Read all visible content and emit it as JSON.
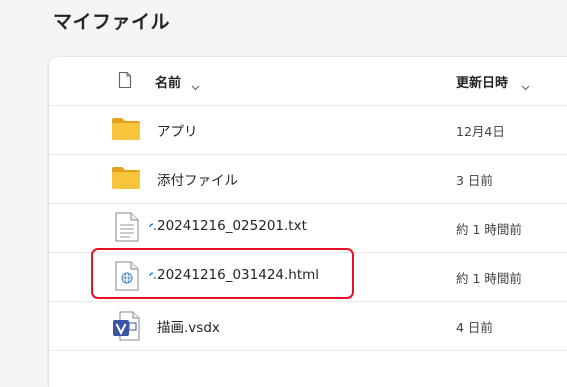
{
  "page": {
    "title": "マイファイル"
  },
  "header": {
    "name_label": "名前",
    "modified_label": "更新日時",
    "type_icon": "document-icon",
    "sort_icon": "chevron-down-icon"
  },
  "files": [
    {
      "name": "アプリ",
      "modified": "12月4日",
      "icon": "folder-icon"
    },
    {
      "name": "添付ファイル",
      "modified": "3 日前",
      "icon": "folder-icon"
    },
    {
      "name": "20241216_025201.txt",
      "modified": "約 1 時間前",
      "icon": "text-file-icon",
      "sync_status": "syncing"
    },
    {
      "name": "20241216_031424.html",
      "modified": "約 1 時間前",
      "icon": "html-file-icon",
      "sync_status": "syncing",
      "highlighted": true
    },
    {
      "name": "描画.vsdx",
      "modified": "4 日前",
      "icon": "visio-file-icon"
    }
  ],
  "colors": {
    "folder": "#f8c43c",
    "highlight_border": "#e81123",
    "visio_blue": "#3955a3",
    "sync_indicator": "#0f6cbd"
  }
}
